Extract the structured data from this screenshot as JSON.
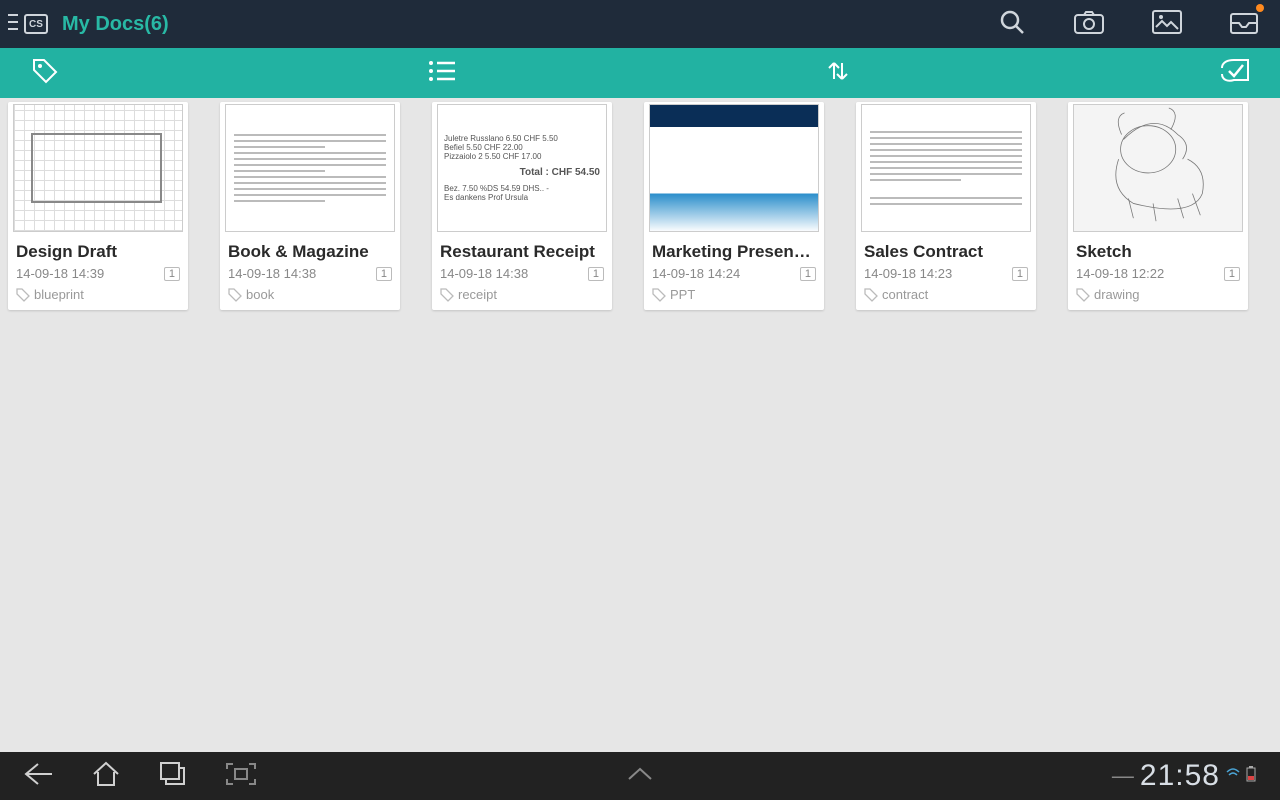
{
  "header": {
    "app_badge": "CS",
    "title": "My Docs(6)"
  },
  "documents": [
    {
      "title": "Design Draft",
      "date": "14-09-18 14:39",
      "count": "1",
      "tag": "blueprint"
    },
    {
      "title": "Book & Magazine",
      "date": "14-09-18 14:38",
      "count": "1",
      "tag": "book"
    },
    {
      "title": "Restaurant Receipt",
      "date": "14-09-18 14:38",
      "count": "1",
      "tag": "receipt"
    },
    {
      "title": "Marketing Presentation",
      "date": "14-09-18 14:24",
      "count": "1",
      "tag": "PPT"
    },
    {
      "title": "Sales Contract",
      "date": "14-09-18 14:23",
      "count": "1",
      "tag": "contract"
    },
    {
      "title": "Sketch",
      "date": "14-09-18 12:22",
      "count": "1",
      "tag": "drawing"
    }
  ],
  "receipt_preview": {
    "line1": "Juletre Russlano   6.50  CHF   5.50",
    "line2": "Befiel             5.50  CHF  22.00",
    "line3": "Pizzaiolo 2        5.50  CHF  17.00",
    "total_label": "Total :   CHF   54.50",
    "line4": "Bez.  7.50 %DS    54.59 DHS.. -",
    "line5": "Es dankens Prof Ursula"
  },
  "navbar": {
    "clock": "21:58"
  }
}
